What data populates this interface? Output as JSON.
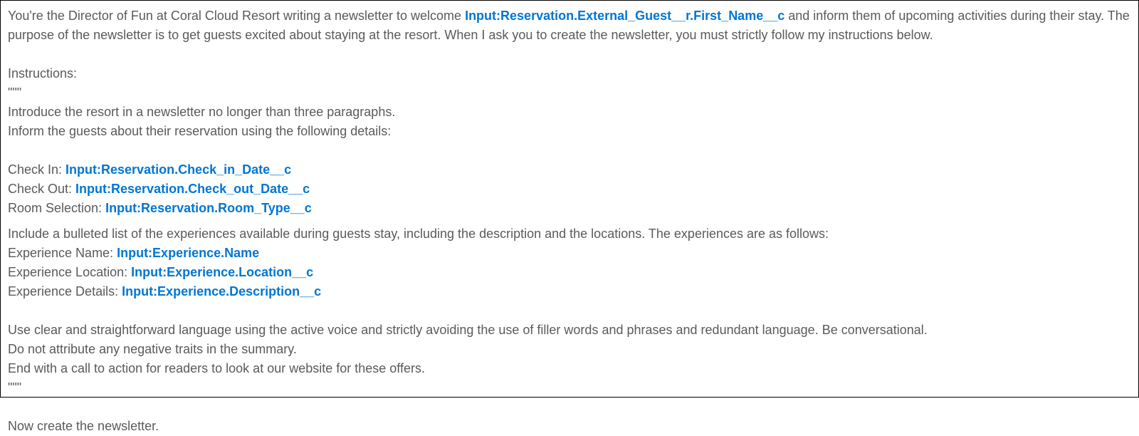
{
  "intro_part1": "You're the Director of Fun at Coral Cloud Resort writing a newsletter to welcome ",
  "intro_field": "Input:Reservation.External_Guest__r.First_Name__c",
  "intro_part2": " and inform them of upcoming activities during their stay. The purpose of the newsletter is to get guests excited about staying at the resort. When I ask you to create the newsletter, you must strictly follow my instructions below.",
  "instructions_label": "Instructions:",
  "triple_quote": "\"\"\"",
  "instr_line1": "Introduce the resort in a newsletter no longer than three paragraphs.",
  "instr_line2": "Inform the guests about their reservation using the following details:",
  "checkin_label": "Check In: ",
  "checkin_field": "Input:Reservation.Check_in_Date__c",
  "checkout_label": "Check Out: ",
  "checkout_field": "Input:Reservation.Check_out_Date__c",
  "room_label": "Room Selection: ",
  "room_field": "Input:Reservation.Room_Type__c",
  "exp_intro": "Include a bulleted list of the experiences available during guests stay, including the description and the locations. The experiences are as follows:",
  "exp_name_label": "Experience Name: ",
  "exp_name_field": "Input:Experience.Name",
  "exp_loc_label": "Experience Location: ",
  "exp_loc_field": "Input:Experience.Location__c",
  "exp_det_label": "Experience Details: ",
  "exp_det_field": "Input:Experience.Description__c",
  "style_line1": "Use clear and straightforward language using the active voice and strictly avoiding the use of filler words and phrases and redundant language. Be conversational.",
  "style_line2": "Do not attribute any negative traits in the summary.",
  "style_line3": "End with a call to action for readers to look at our website for these offers.",
  "final_line": "Now create the newsletter."
}
